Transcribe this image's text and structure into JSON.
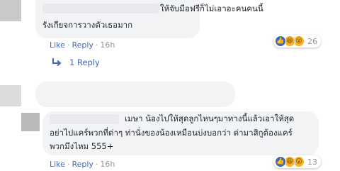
{
  "comments": [
    {
      "author": "",
      "lines": [
        "ให้จับมือฟรีก็ไม่เอาอะคนคนนี้",
        "รังเกียจการวางตัวเธอมาก"
      ],
      "like_label": "Like",
      "reply_label": "Reply",
      "separator": "·",
      "time": "16h",
      "reaction_count": "26"
    },
    {
      "author": "",
      "lines": [
        "เมษา น้องไปให้สุดลูกไหนๆมาทางนี้แล้วเอาให้สุด",
        "อย่าไปแคร์พวกที่ด่าๆ ท่านั่งของน้องเหมือนบ่งบอกว่า ด่ามาสิกูต้องแคร์",
        "พวกมึงไหม 555+"
      ],
      "like_label": "Like",
      "reply_label": "Reply",
      "separator": "·",
      "time": "16h",
      "reaction_count": "13"
    }
  ],
  "replies_link": {
    "label": "1 Reply",
    "icon": "reply-arrow-icon"
  },
  "reaction_icons": [
    "like-icon",
    "haha-icon",
    "wow-icon"
  ],
  "colors": {
    "link": "#4267b2",
    "bubble": "#f2f3f5",
    "meta": "#90949c",
    "text": "#1d2129"
  }
}
